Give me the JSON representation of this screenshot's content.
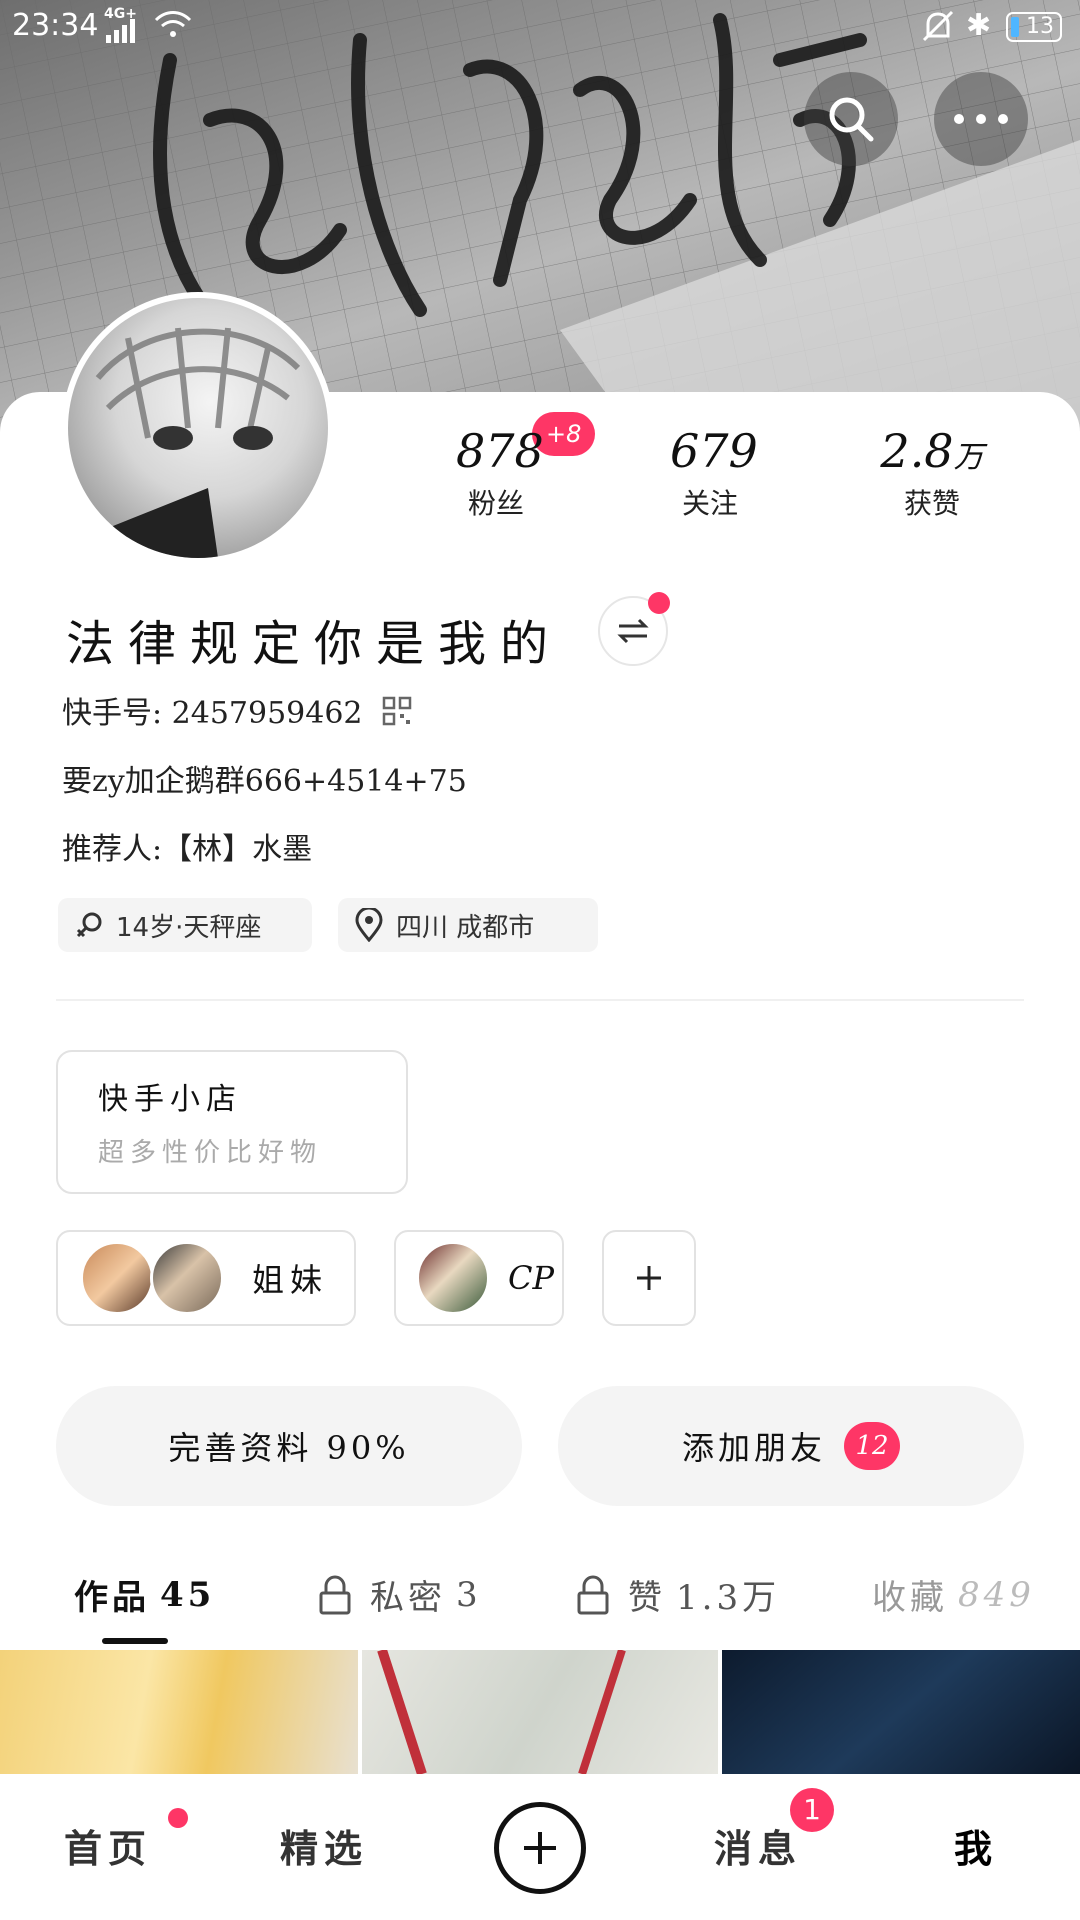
{
  "status_bar": {
    "time": "23:34",
    "network": "4G+",
    "battery": "13"
  },
  "profile": {
    "stats": [
      {
        "value": "878",
        "label": "粉丝",
        "badge": "+8"
      },
      {
        "value": "679",
        "label": "关注"
      },
      {
        "value": "2.8",
        "unit": "万",
        "label": "获赞"
      }
    ],
    "name": "法律规定你是我的",
    "kuaishou_id": "快手号: 2457959462",
    "bio": "要zy加企鹅群666+4514+75",
    "recommender": "推荐人:【林】水墨",
    "tags": {
      "age_sign": "14岁·天秤座",
      "location": "四川 成都市"
    }
  },
  "shop": {
    "title": "快手小店",
    "subtitle": "超多性价比好物"
  },
  "relations": {
    "sisters_label": "姐妹",
    "cp_label": "CP",
    "add_label": "+"
  },
  "actions": {
    "complete_profile": "完善资料 90%",
    "add_friends": "添加朋友",
    "add_friends_count": "12"
  },
  "tabs": [
    {
      "label": "作品",
      "count": "45"
    },
    {
      "label": "私密",
      "count": "3"
    },
    {
      "label": "赞",
      "count": "1.3万"
    },
    {
      "label": "收藏",
      "count": "849"
    }
  ],
  "bottom_nav": {
    "home": "首页",
    "featured": "精选",
    "messages": "消息",
    "messages_badge": "1",
    "me": "我"
  },
  "colors": {
    "accent": "#fe3666",
    "chip_bg": "#f4f4f4",
    "border": "#e2e2e2"
  },
  "icons": [
    "search-icon",
    "more-icon",
    "swap-icon",
    "qr-code-icon",
    "gender-female-icon",
    "location-pin-icon",
    "plus-icon",
    "lock-icon",
    "create-icon"
  ]
}
